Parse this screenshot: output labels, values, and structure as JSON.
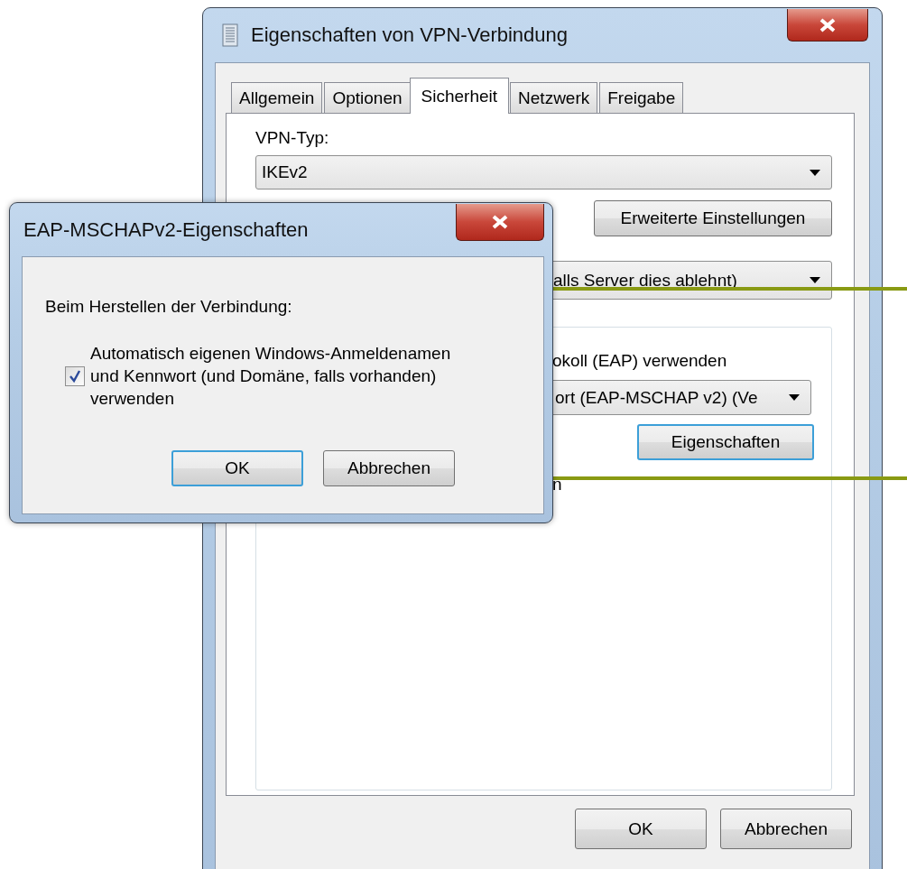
{
  "main_window": {
    "title": "Eigenschaften von VPN-Verbindung",
    "tabs": [
      {
        "label": "Allgemein",
        "selected": false
      },
      {
        "label": "Optionen",
        "selected": false
      },
      {
        "label": "Sicherheit",
        "selected": true
      },
      {
        "label": "Netzwerk",
        "selected": false
      },
      {
        "label": "Freigabe",
        "selected": false
      }
    ],
    "vpn_type_label": "VPN-Typ:",
    "vpn_type_select": {
      "value": "IKEv2"
    },
    "advanced_button": "Erweiterte Einstellungen",
    "encryption_select": {
      "value": "alls Server dies ablehnt)"
    },
    "auth_group": {
      "eap_option_label": "okoll (EAP) verwenden",
      "eap_select": {
        "value": "ort (EAP-MSCHAP v2) (Ve"
      },
      "properties_button": "Eigenschaften",
      "cut_text": "n"
    },
    "buttons": [
      "OK",
      "Abbrechen"
    ]
  },
  "dialog": {
    "title": "EAP-MSCHAPv2-Eigenschaften",
    "prompt": "Beim Herstellen der Verbindung:",
    "auto_logon": {
      "label": "Automatisch eigenen Windows-Anmeldenamen und Kennwort (und Domäne, falls vorhanden) verwenden",
      "checked": true
    },
    "buttons": [
      "OK",
      "Abbrechen"
    ]
  }
}
